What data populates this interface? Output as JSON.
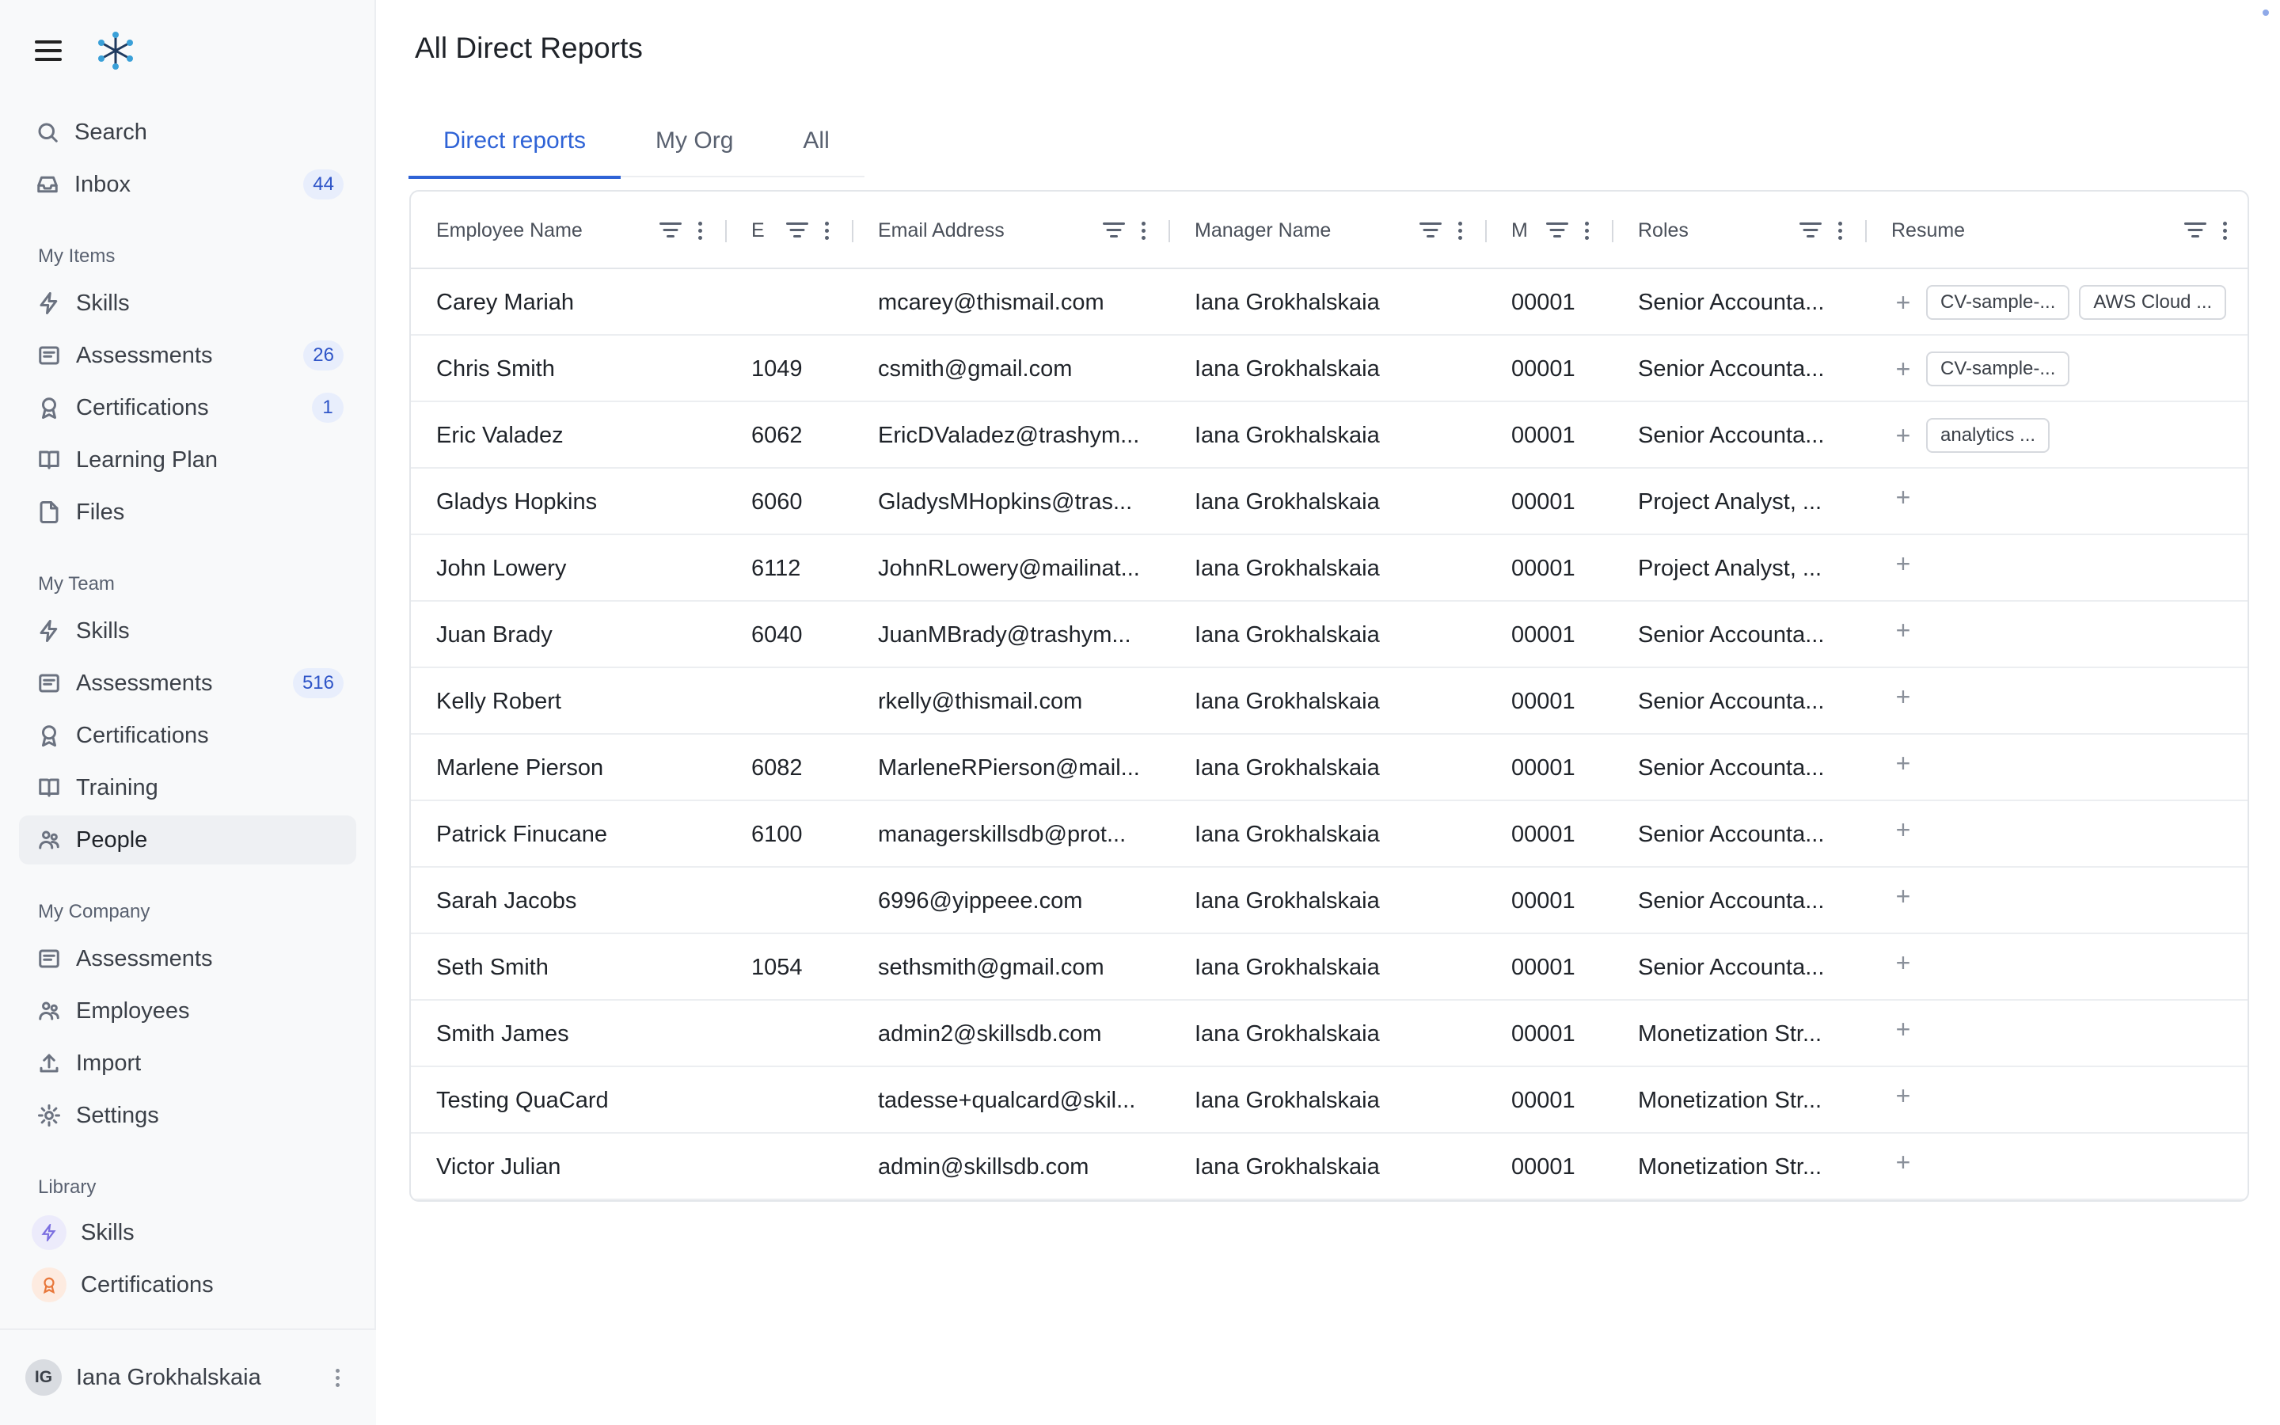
{
  "sidebar": {
    "top_items": [
      {
        "label": "Search",
        "icon": "search-icon"
      },
      {
        "label": "Inbox",
        "icon": "inbox-icon",
        "badge": "44"
      }
    ],
    "my_items": {
      "title": "My Items",
      "items": [
        {
          "label": "Skills",
          "icon": "bolt-icon"
        },
        {
          "label": "Assessments",
          "icon": "assessment-icon",
          "badge": "26"
        },
        {
          "label": "Certifications",
          "icon": "award-icon",
          "badge": "1"
        },
        {
          "label": "Learning Plan",
          "icon": "book-icon"
        },
        {
          "label": "Files",
          "icon": "file-icon"
        }
      ]
    },
    "my_team": {
      "title": "My Team",
      "items": [
        {
          "label": "Skills",
          "icon": "bolt-icon"
        },
        {
          "label": "Assessments",
          "icon": "assessment-icon",
          "badge": "516"
        },
        {
          "label": "Certifications",
          "icon": "award-icon"
        },
        {
          "label": "Training",
          "icon": "book-icon"
        },
        {
          "label": "People",
          "icon": "people-icon",
          "active": true
        }
      ]
    },
    "my_company": {
      "title": "My Company",
      "items": [
        {
          "label": "Assessments",
          "icon": "assessment-icon"
        },
        {
          "label": "Employees",
          "icon": "people-icon"
        },
        {
          "label": "Import",
          "icon": "upload-icon"
        },
        {
          "label": "Settings",
          "icon": "gear-icon"
        }
      ]
    },
    "library": {
      "title": "Library",
      "items": [
        {
          "label": "Skills",
          "icon": "bolt-icon"
        },
        {
          "label": "Certifications",
          "icon": "award-icon"
        }
      ]
    },
    "user": {
      "initials": "IG",
      "name": "Iana Grokhalskaia"
    }
  },
  "main": {
    "title": "All Direct Reports",
    "tabs": [
      "Direct reports",
      "My Org",
      "All"
    ],
    "active_tab": "Direct reports"
  },
  "table": {
    "headers": {
      "name": "Employee Name",
      "employee_id": "E",
      "email": "Email Address",
      "manager": "Manager Name",
      "manager_id": "M",
      "roles": "Roles",
      "resume": "Resume"
    },
    "rows": [
      {
        "name": "Carey Mariah",
        "id": "",
        "email": "mcarey@thismail.com",
        "manager": "Iana Grokhalskaia",
        "mid": "00001",
        "roles": "Senior Accounta...",
        "resume": [
          "CV-sample-...",
          "AWS Cloud ..."
        ]
      },
      {
        "name": "Chris Smith",
        "id": "1049",
        "email": "csmith@gmail.com",
        "manager": "Iana Grokhalskaia",
        "mid": "00001",
        "roles": "Senior Accounta...",
        "resume": [
          "CV-sample-..."
        ]
      },
      {
        "name": "Eric Valadez",
        "id": "6062",
        "email": "EricDValadez@trashym...",
        "manager": "Iana Grokhalskaia",
        "mid": "00001",
        "roles": "Senior Accounta...",
        "resume": [
          "analytics ..."
        ]
      },
      {
        "name": "Gladys Hopkins",
        "id": "6060",
        "email": "GladysMHopkins@tras...",
        "manager": "Iana Grokhalskaia",
        "mid": "00001",
        "roles": "Project Analyst, ...",
        "resume": []
      },
      {
        "name": "John Lowery",
        "id": "6112",
        "email": "JohnRLowery@mailinat...",
        "manager": "Iana Grokhalskaia",
        "mid": "00001",
        "roles": "Project Analyst, ...",
        "resume": []
      },
      {
        "name": "Juan Brady",
        "id": "6040",
        "email": "JuanMBrady@trashym...",
        "manager": "Iana Grokhalskaia",
        "mid": "00001",
        "roles": "Senior Accounta...",
        "resume": []
      },
      {
        "name": "Kelly Robert",
        "id": "",
        "email": "rkelly@thismail.com",
        "manager": "Iana Grokhalskaia",
        "mid": "00001",
        "roles": "Senior Accounta...",
        "resume": []
      },
      {
        "name": "Marlene Pierson",
        "id": "6082",
        "email": "MarleneRPierson@mail...",
        "manager": "Iana Grokhalskaia",
        "mid": "00001",
        "roles": "Senior Accounta...",
        "resume": []
      },
      {
        "name": "Patrick Finucane",
        "id": "6100",
        "email": "managerskillsdb@prot...",
        "manager": "Iana Grokhalskaia",
        "mid": "00001",
        "roles": "Senior Accounta...",
        "resume": []
      },
      {
        "name": "Sarah Jacobs",
        "id": "",
        "email": "6996@yippeee.com",
        "manager": "Iana Grokhalskaia",
        "mid": "00001",
        "roles": "Senior Accounta...",
        "resume": []
      },
      {
        "name": "Seth Smith",
        "id": "1054",
        "email": "sethsmith@gmail.com",
        "manager": "Iana Grokhalskaia",
        "mid": "00001",
        "roles": "Senior Accounta...",
        "resume": []
      },
      {
        "name": "Smith James",
        "id": "",
        "email": "admin2@skillsdb.com",
        "manager": "Iana Grokhalskaia",
        "mid": "00001",
        "roles": "Monetization Str...",
        "resume": []
      },
      {
        "name": "Testing QuaCard",
        "id": "",
        "email": "tadesse+qualcard@skil...",
        "manager": "Iana Grokhalskaia",
        "mid": "00001",
        "roles": "Monetization Str...",
        "resume": []
      },
      {
        "name": "Victor Julian",
        "id": "",
        "email": "admin@skillsdb.com",
        "manager": "Iana Grokhalskaia",
        "mid": "00001",
        "roles": "Monetization Str...",
        "resume": []
      }
    ]
  },
  "colors": {
    "accent": "#2f63d6",
    "badge_bg": "#e8eefc",
    "sidebar_bg": "#f8f9fa"
  }
}
